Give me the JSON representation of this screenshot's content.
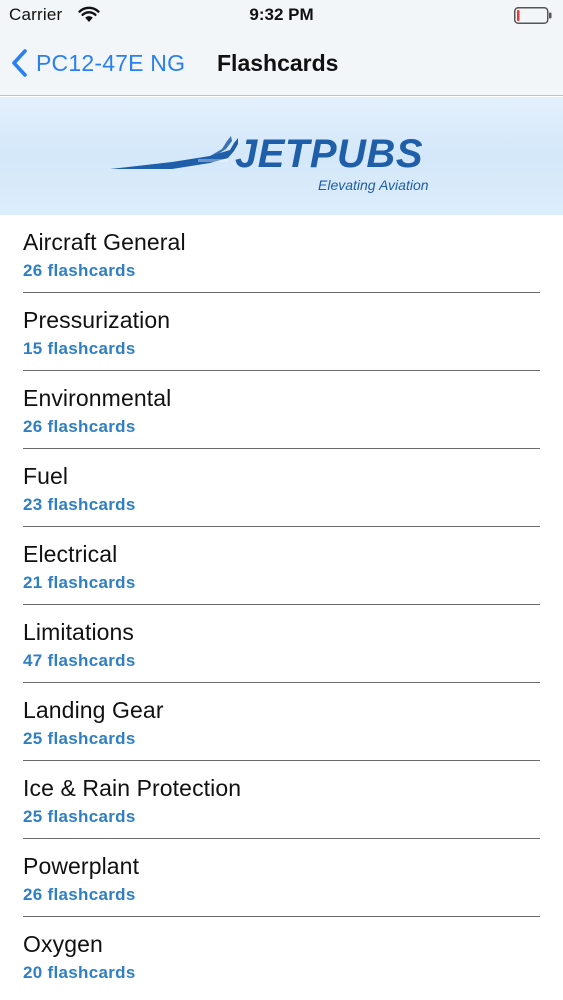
{
  "status_bar": {
    "carrier": "Carrier",
    "time": "9:32 PM",
    "battery_level": 0.08,
    "battery_color": "#e53935"
  },
  "nav": {
    "back_label": "PC12-47E NG",
    "title": "Flashcards",
    "accent": "#2a7ff1"
  },
  "banner": {
    "brand": "JETPUBS",
    "tagline": "Elevating Aviation",
    "brand_color": "#1f5ea8"
  },
  "list": {
    "items": [
      {
        "title": "Aircraft General",
        "count": "26 flashcards"
      },
      {
        "title": "Pressurization",
        "count": "15 flashcards"
      },
      {
        "title": "Environmental",
        "count": "26 flashcards"
      },
      {
        "title": "Fuel",
        "count": "23 flashcards"
      },
      {
        "title": "Electrical",
        "count": "21 flashcards"
      },
      {
        "title": "Limitations",
        "count": "47 flashcards"
      },
      {
        "title": "Landing Gear",
        "count": "25 flashcards"
      },
      {
        "title": "Ice & Rain Protection",
        "count": "25 flashcards"
      },
      {
        "title": "Powerplant",
        "count": "26 flashcards"
      },
      {
        "title": "Oxygen",
        "count": "20 flashcards"
      }
    ]
  }
}
